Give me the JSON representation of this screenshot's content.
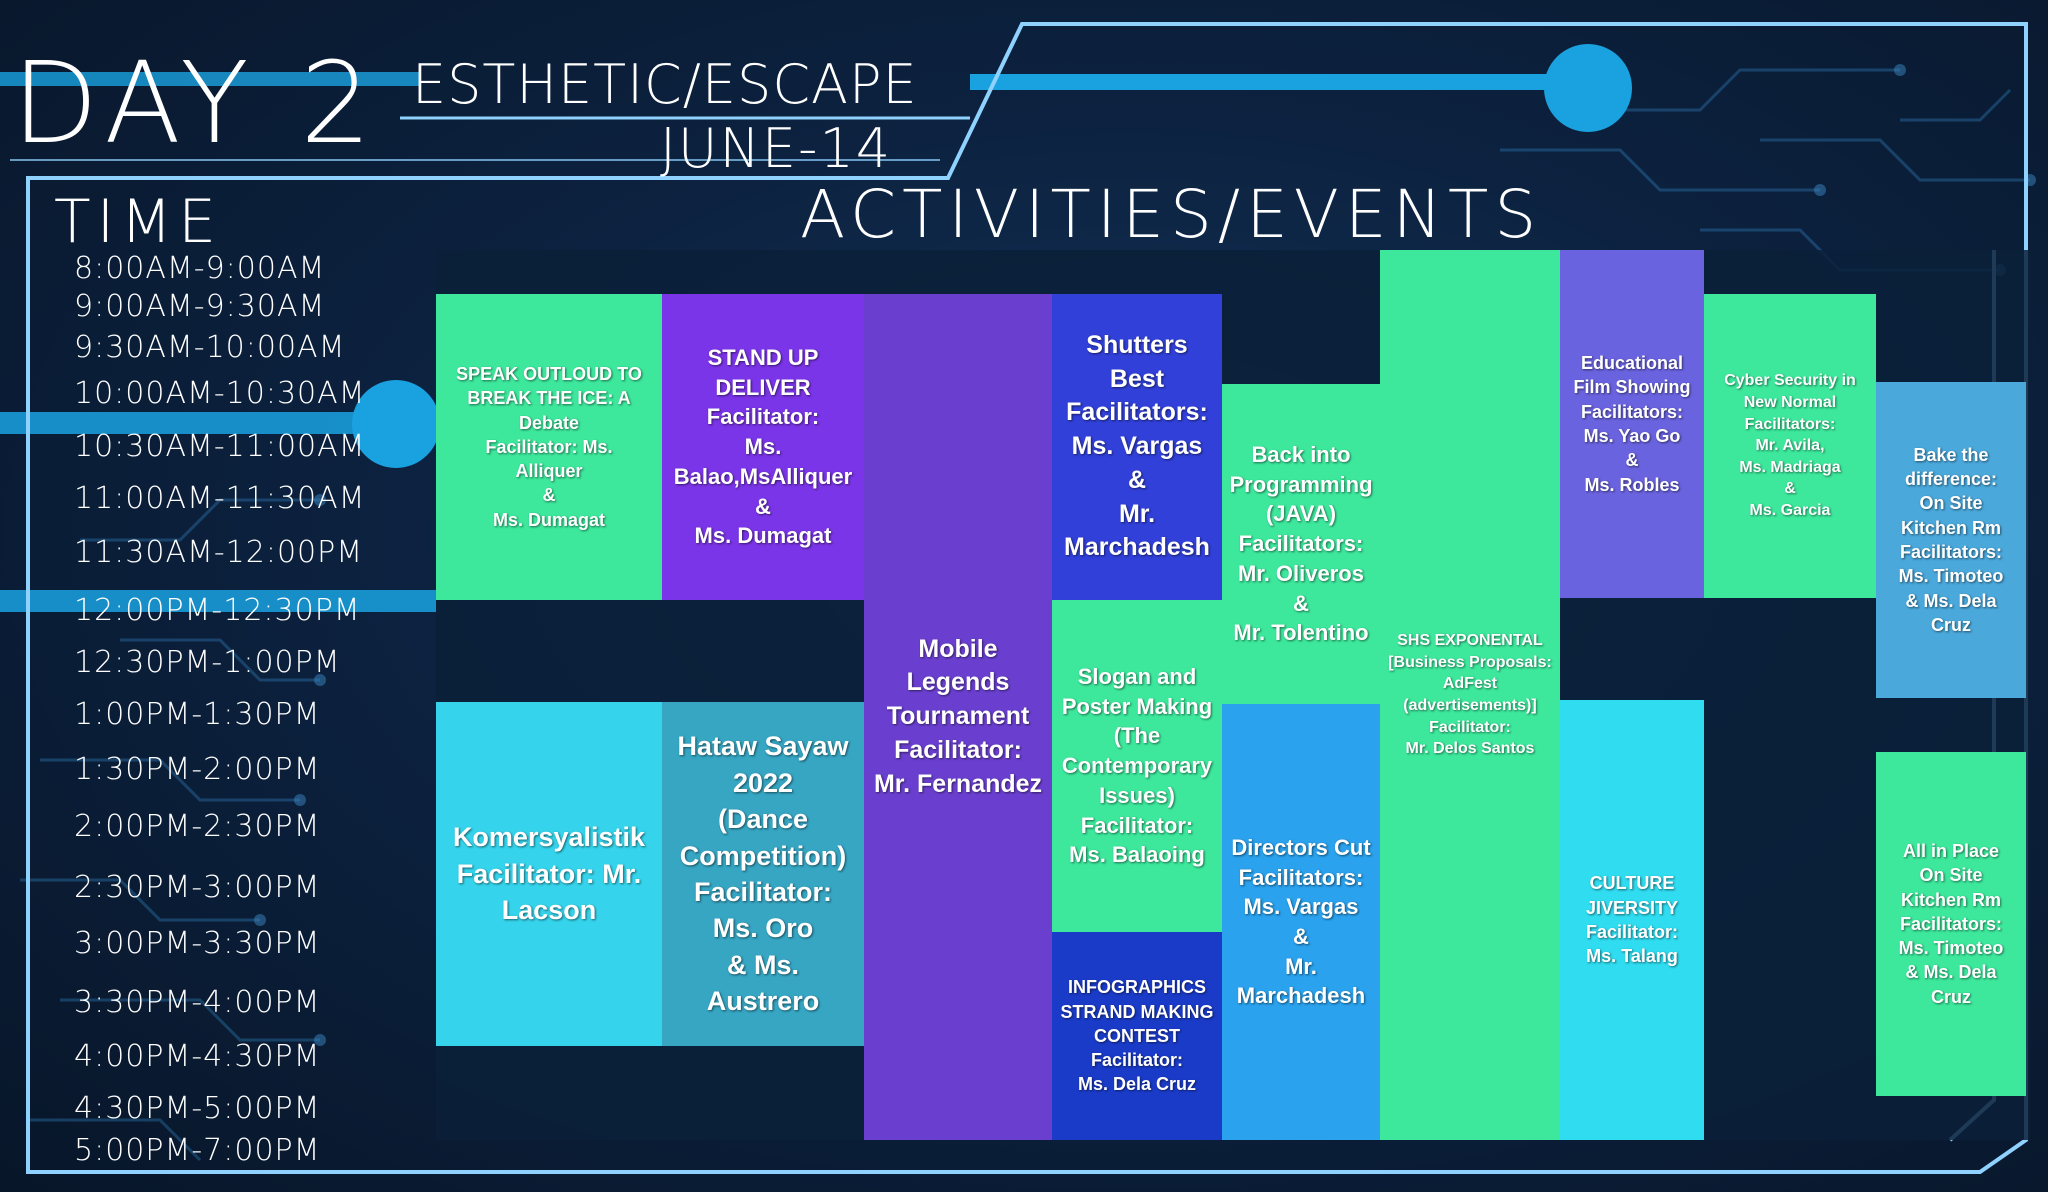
{
  "header": {
    "day": "DAY 2",
    "theme": "ESTHETIC/ESCAPE",
    "date": "JUNE-14",
    "time_label": "TIME",
    "activities_label": "ACTIVITIES/EVENTS"
  },
  "colors": {
    "background": "#0c2240",
    "accent_cyan": "#19a9e0",
    "green": "#3de89c",
    "purple": "#6a3fcf",
    "violet": "#7b35e8",
    "blue": "#3140d9",
    "cyan": "#35d4ec",
    "teal": "#36a6c3",
    "periwinkle": "#6a63df",
    "sky": "#4aa8db",
    "bright_cyan": "#30dcf0",
    "navy": "#1a3bc8",
    "azure": "#2aa2ee"
  },
  "time_slots": [
    "8:00AM-9:00AM",
    "9:00AM-9:30AM",
    "9:30AM-10:00AM",
    "10:00AM-10:30AM",
    "10:30AM-11:00AM",
    "11:00AM-11:30AM",
    "11:30AM-12:00PM",
    "12:00PM-12:30PM",
    "12:30PM-1:00PM",
    "1:00PM-1:30PM",
    "1:30PM-2:00PM",
    "2:00PM-2:30PM",
    "2:30PM-3:00PM",
    "3:00PM-3:30PM",
    "3:30PM-4:00PM",
    "4:00PM-4:30PM",
    "4:30PM-5:00PM",
    "5:00PM-7:00PM"
  ],
  "events": {
    "debate": "SPEAK OUTLOUD TO\nBREAK THE ICE: A\nDebate\nFacilitator: Ms.\nAlliquer\n&\nMs. Dumagat",
    "stand_up": "STAND UP DELIVER\nFacilitator:\nMs. Balao,MsAlliquer\n&\nMs. Dumagat",
    "mobile_legends": "Mobile\nLegends\nTournament\nFacilitator:\nMr. Fernandez",
    "shutters": "Shutters Best\nFacilitators:\nMs. Vargas\n&\nMr.\nMarchadesh",
    "slogan": "Slogan and\nPoster Making\n(The\nContemporary\nIssues)\nFacilitator:\nMs. Balaoing",
    "infographics": "INFOGRAPHICS\nSTRAND MAKING\nCONTEST\nFacilitator:\nMs. Dela Cruz",
    "java": "Back into\nProgramming\n(JAVA)\nFacilitators:\nMr. Oliveros &\nMr. Tolentino",
    "directors_cut": "Directors Cut\nFacilitators:\nMs. Vargas\n&\nMr.\nMarchadesh",
    "shs_exponental": "SHS EXPONENTAL\n[Business Proposals:\nAdFest\n(advertisements)]\nFacilitator:\nMr. Delos Santos",
    "film_showing": "Educational\nFilm Showing\nFacilitators:\nMs. Yao Go\n&\nMs. Robles",
    "culture": "CULTURE\nJIVERSITY\nFacilitator:\nMs. Talang",
    "cyber_security": "Cyber Security in\nNew Normal\nFacilitators:\nMr. Avila,\nMs. Madriaga\n&\nMs. Garcia",
    "bake": "Bake the\ndifference:\nOn Site\nKitchen Rm\nFacilitators:\nMs. Timoteo\n& Ms. Dela\nCruz",
    "all_in_place": "All in Place\nOn Site\nKitchen Rm\nFacilitators:\nMs. Timoteo\n& Ms. Dela\nCruz",
    "komersyalistik": "Komersyalistik\nFacilitator: Mr.\nLacson",
    "hataw": "Hataw Sayaw\n2022\n(Dance\nCompetition)\nFacilitator:\nMs. Oro\n& Ms. Austrero"
  }
}
